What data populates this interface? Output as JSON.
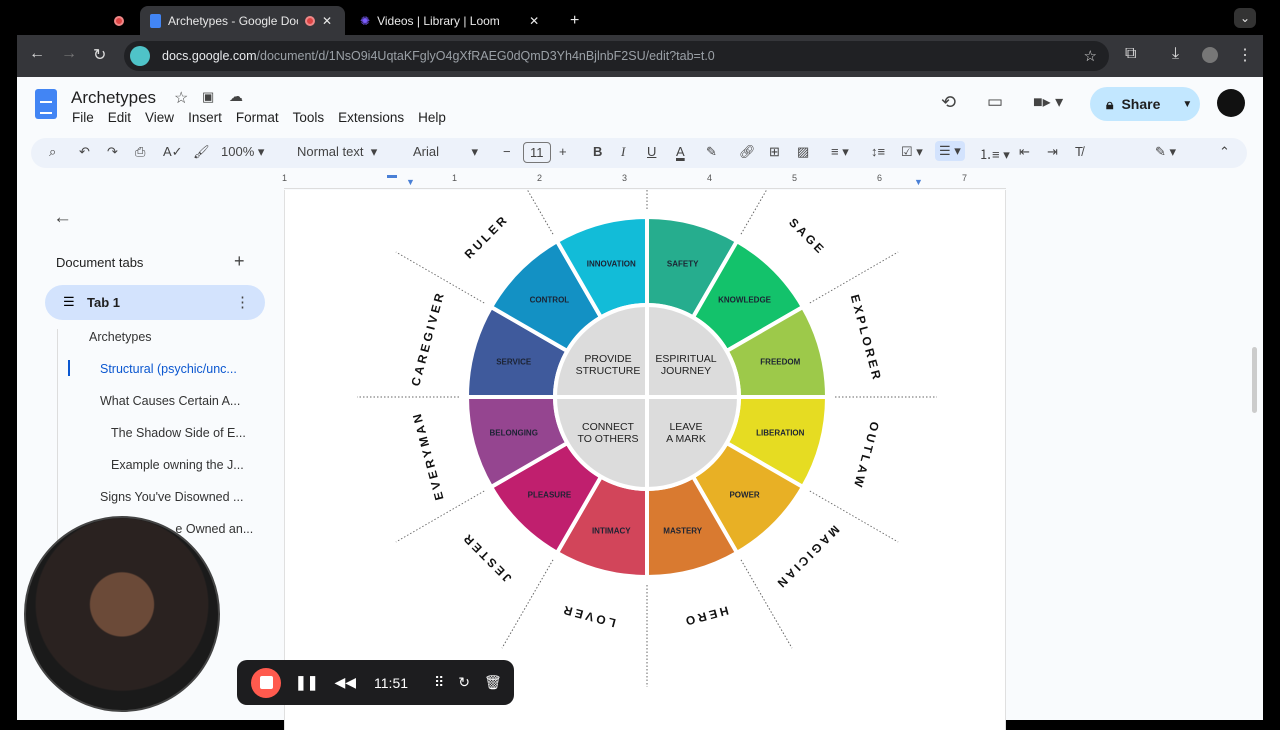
{
  "browser": {
    "tabs": [
      {
        "label": "Archetypes - Google Docs",
        "active": true
      },
      {
        "label": "Videos | Library | Loom",
        "active": false
      }
    ],
    "url_host": "docs.google.com",
    "url_path": "/document/d/1NsO9i4UqtaKFglyO4gXfRAEG0dQmD3Yh4nBjlnbF2SU/edit?tab=t.0"
  },
  "doc": {
    "title": "Archetypes",
    "menu": [
      "File",
      "Edit",
      "View",
      "Insert",
      "Format",
      "Tools",
      "Extensions",
      "Help"
    ],
    "share_label": "Share",
    "toolbar": {
      "zoom": "100%",
      "style": "Normal text",
      "font": "Arial",
      "font_size": "11"
    },
    "ruler": [
      "1",
      "1",
      "2",
      "3",
      "4",
      "5",
      "6",
      "7"
    ]
  },
  "sidebar": {
    "heading": "Document tabs",
    "tab": "Tab 1",
    "outline": [
      "Archetypes",
      "Structural (psychic/unc...",
      "What Causes Certain A...",
      "The Shadow Side of E...",
      "Example owning the J...",
      "Signs You've Disowned ...",
      "...e Owned an..."
    ]
  },
  "wheel": {
    "core": [
      "PROVIDE STRUCTURE",
      "ESPIRITUAL JOURNEY",
      "CONNECT TO OTHERS",
      "LEAVE A MARK"
    ],
    "segments": [
      {
        "label": "SAFETY",
        "color": "#26ad8e"
      },
      {
        "label": "KNOWLEDGE",
        "color": "#13c26b"
      },
      {
        "label": "FREEDOM",
        "color": "#9dc94a"
      },
      {
        "label": "LIBERATION",
        "color": "#e6dc22"
      },
      {
        "label": "POWER",
        "color": "#e8b025"
      },
      {
        "label": "MASTERY",
        "color": "#d97a30"
      },
      {
        "label": "INTIMACY",
        "color": "#d2455a"
      },
      {
        "label": "PLEASURE",
        "color": "#c01f6e"
      },
      {
        "label": "BELONGING",
        "color": "#954590"
      },
      {
        "label": "SERVICE",
        "color": "#3f5a9c"
      },
      {
        "label": "CONTROL",
        "color": "#1391c4"
      },
      {
        "label": "INNOVATION",
        "color": "#12bcd8"
      }
    ],
    "archetypes": [
      {
        "label": "SAGE",
        "angle": 45
      },
      {
        "label": "EXPLORER",
        "angle": 75
      },
      {
        "label": "OUTLAW",
        "angle": 105
      },
      {
        "label": "MAGICIAN",
        "angle": 135
      },
      {
        "label": "HERO",
        "angle": 165
      },
      {
        "label": "LOVER",
        "angle": 195
      },
      {
        "label": "JESTER",
        "angle": 225
      },
      {
        "label": "EVERYMAN",
        "angle": 255
      },
      {
        "label": "CAREGIVER",
        "angle": 285
      },
      {
        "label": "RULER",
        "angle": 315
      }
    ]
  },
  "loom": {
    "time": "11:51"
  }
}
